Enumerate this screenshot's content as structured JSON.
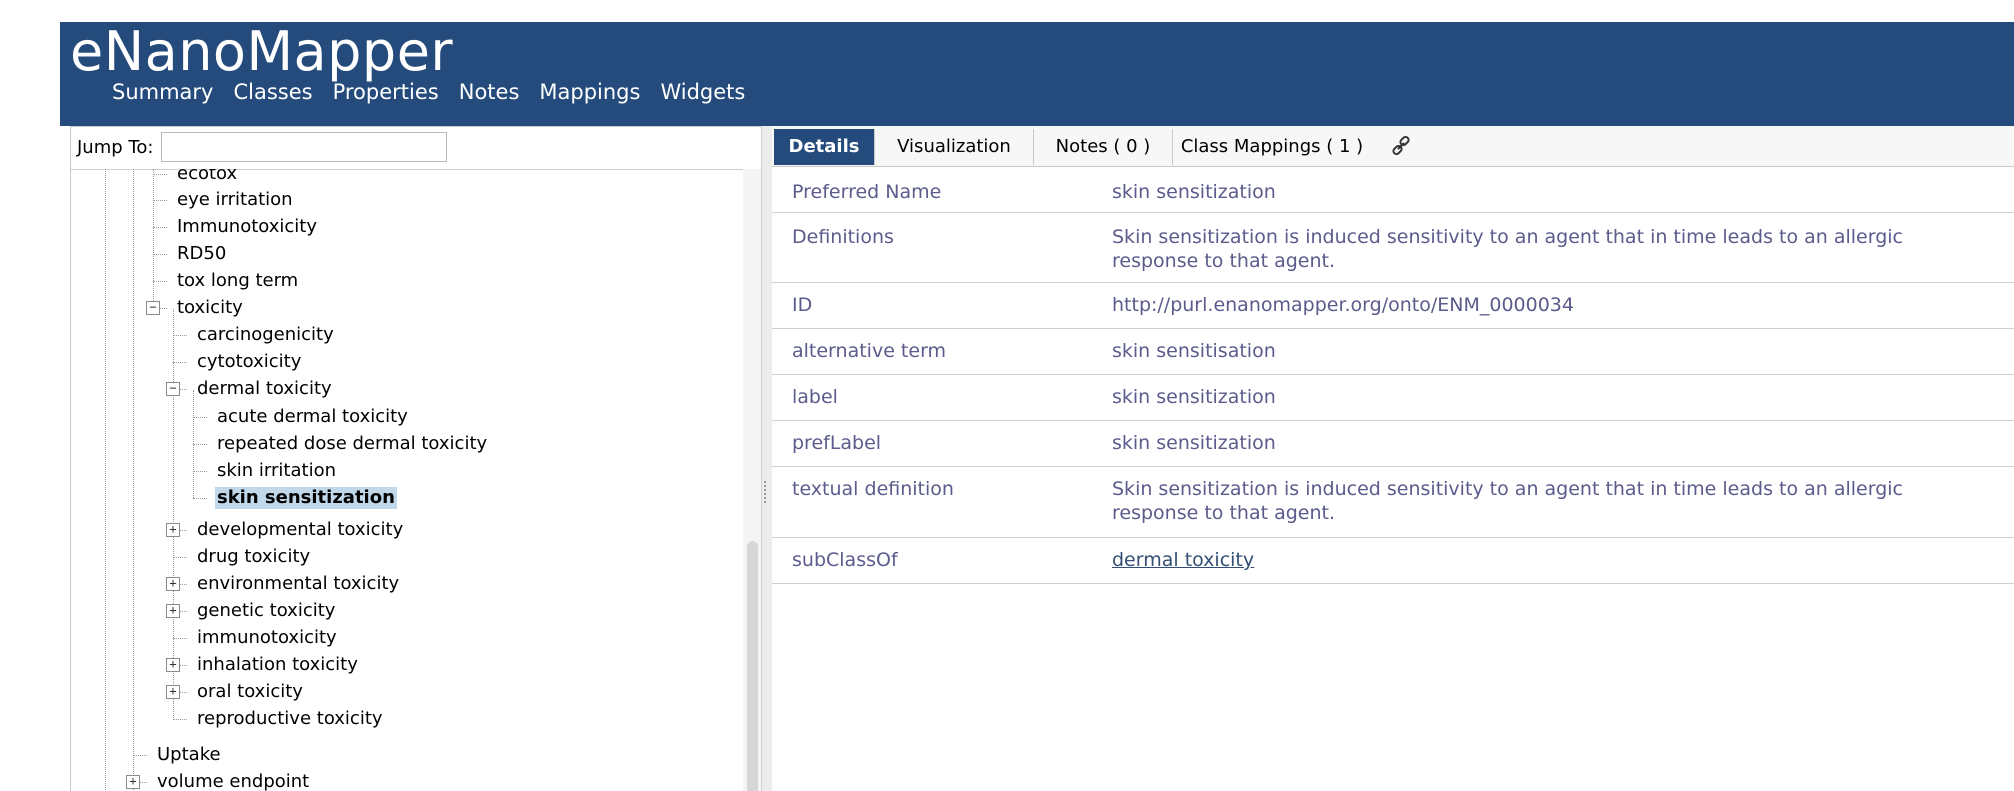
{
  "app": {
    "title": "eNanoMapper"
  },
  "nav": [
    "Summary",
    "Classes",
    "Properties",
    "Notes",
    "Mappings",
    "Widgets"
  ],
  "jump": {
    "label": "Jump To:",
    "value": ""
  },
  "tree": {
    "items": [
      {
        "label": "ecotox",
        "level": 2,
        "toggle": ""
      },
      {
        "label": "eye irritation",
        "level": 2,
        "toggle": ""
      },
      {
        "label": "Immunotoxicity",
        "level": 2,
        "toggle": ""
      },
      {
        "label": "RD50",
        "level": 2,
        "toggle": ""
      },
      {
        "label": "tox long term",
        "level": 2,
        "toggle": ""
      },
      {
        "label": "toxicity",
        "level": 2,
        "toggle": "minus"
      },
      {
        "label": "carcinogenicity",
        "level": 3,
        "toggle": ""
      },
      {
        "label": "cytotoxicity",
        "level": 3,
        "toggle": ""
      },
      {
        "label": "dermal toxicity",
        "level": 3,
        "toggle": "minus"
      },
      {
        "label": "acute dermal toxicity",
        "level": 4,
        "toggle": ""
      },
      {
        "label": "repeated dose dermal toxicity",
        "level": 4,
        "toggle": ""
      },
      {
        "label": "skin irritation",
        "level": 4,
        "toggle": ""
      },
      {
        "label": "skin sensitization",
        "level": 4,
        "toggle": "",
        "selected": true
      },
      {
        "label": "developmental toxicity",
        "level": 3,
        "toggle": "plus"
      },
      {
        "label": "drug toxicity",
        "level": 3,
        "toggle": ""
      },
      {
        "label": "environmental toxicity",
        "level": 3,
        "toggle": "plus"
      },
      {
        "label": "genetic toxicity",
        "level": 3,
        "toggle": "plus"
      },
      {
        "label": "immunotoxicity",
        "level": 3,
        "toggle": ""
      },
      {
        "label": "inhalation toxicity",
        "level": 3,
        "toggle": "plus"
      },
      {
        "label": "oral toxicity",
        "level": 3,
        "toggle": "plus"
      },
      {
        "label": "reproductive toxicity",
        "level": 3,
        "toggle": ""
      },
      {
        "label": "Uptake",
        "level": 1,
        "toggle": ""
      },
      {
        "label": "volume endpoint",
        "level": 1,
        "toggle": "plus"
      }
    ]
  },
  "tabs": [
    "Details",
    "Visualization",
    "Notes ( 0 )",
    "Class Mappings ( 1 )"
  ],
  "details": [
    {
      "key": "Preferred Name",
      "value": "skin sensitization"
    },
    {
      "key": "Definitions",
      "value": "Skin sensitization is induced sensitivity to an agent that in time leads to an allergic response to that agent."
    },
    {
      "key": "ID",
      "value": "http://purl.enanomapper.org/onto/ENM_0000034"
    },
    {
      "key": "alternative term",
      "value": "skin sensitisation"
    },
    {
      "key": "label",
      "value": "skin sensitization"
    },
    {
      "key": "prefLabel",
      "value": "skin sensitization"
    },
    {
      "key": "textual definition",
      "value": "Skin sensitization is induced sensitivity to an agent that in time leads to an allergic response to that agent."
    },
    {
      "key": "subClassOf",
      "value": "dermal toxicity",
      "link": true
    }
  ],
  "colors": {
    "header": "#244b7c",
    "selected": "#c1d7ea",
    "detail_text": "#5b5b8c"
  }
}
